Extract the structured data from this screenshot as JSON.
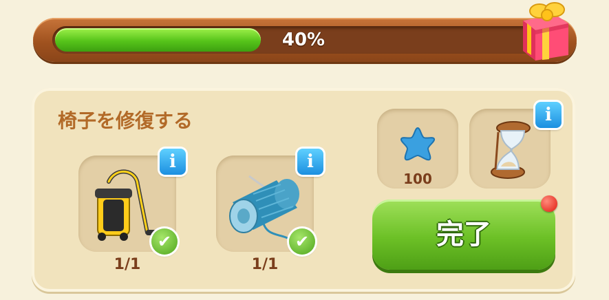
{
  "progress": {
    "percent": 40,
    "label": "40%"
  },
  "task": {
    "title": "椅子を修復する",
    "items": [
      {
        "icon": "vacuum-cleaner-icon",
        "count": "1/1",
        "complete": true
      },
      {
        "icon": "thread-spool-icon",
        "count": "1/1",
        "complete": true
      }
    ]
  },
  "reward": {
    "icon": "blue-star-icon",
    "value": "100"
  },
  "timer": {
    "icon": "hourglass-icon"
  },
  "info_glyph": "i",
  "check_glyph": "✔",
  "complete_button": {
    "label": "完了"
  },
  "colors": {
    "accent_green": "#6cc026",
    "bar_brown": "#a0521f",
    "title_brown": "#b26a28",
    "info_blue": "#1c8fe0"
  }
}
